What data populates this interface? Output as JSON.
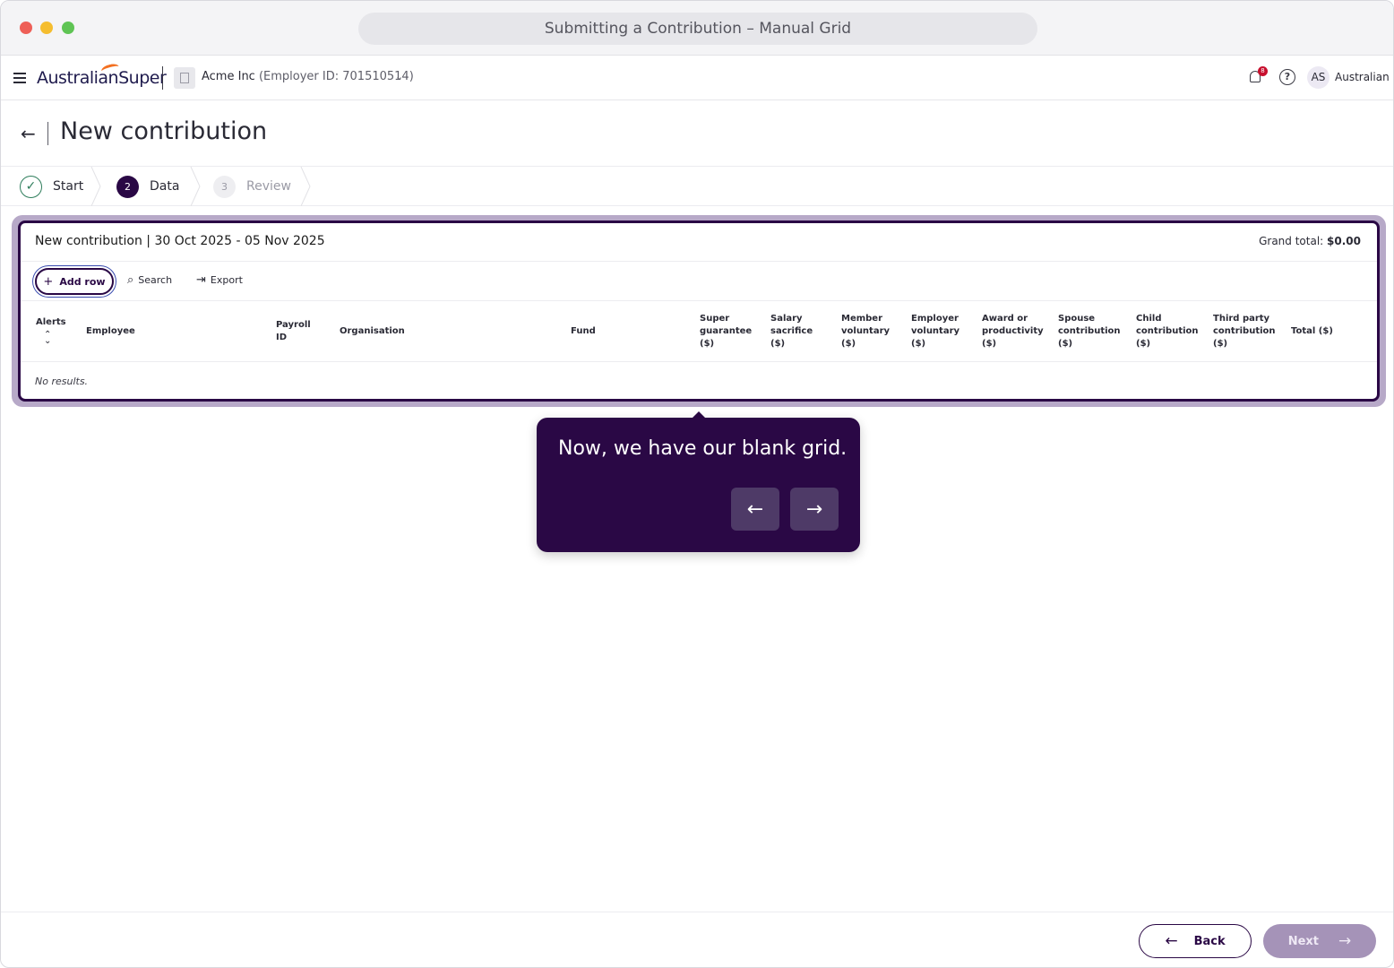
{
  "window": {
    "title": "Submitting a Contribution – Manual Grid"
  },
  "header": {
    "menu_icon": "hamburger-icon",
    "logo_text": "AustralianSuper",
    "org_name": "Acme Inc",
    "org_id": "(Employer ID: 701510514)",
    "notification_count": "8",
    "avatar_initials": "AS",
    "user_name": "Australian"
  },
  "page": {
    "title": "New contribution",
    "back_icon": "arrow-left-icon"
  },
  "stepper": {
    "steps": [
      {
        "marker": "✓",
        "label": "Start",
        "state": "complete"
      },
      {
        "marker": "2",
        "label": "Data",
        "state": "active"
      },
      {
        "marker": "3",
        "label": "Review",
        "state": "upcoming"
      }
    ]
  },
  "grid": {
    "title": "New contribution | 30 Oct 2025 - 05 Nov 2025",
    "grand_total_label": "Grand total:",
    "grand_total_value": "$0.00",
    "toolbar": {
      "add_row": "Add row",
      "search": "Search",
      "export": "Export"
    },
    "columns": [
      "Alerts",
      "Employee",
      "Payroll ID",
      "Organisation",
      "Fund",
      "Super guarantee ($)",
      "Salary sacrifice ($)",
      "Member voluntary ($)",
      "Employer voluntary ($)",
      "Award or productivity ($)",
      "Spouse contribution ($)",
      "Child contribution ($)",
      "Third party contribution ($)",
      "Total ($)"
    ],
    "empty_text": "No results."
  },
  "tooltip": {
    "text": "Now, we have our blank grid.",
    "prev_icon": "arrow-left-icon",
    "next_icon": "arrow-right-icon"
  },
  "footer": {
    "back_label": "Back",
    "next_label": "Next"
  },
  "colors": {
    "brand_primary": "#2a0845",
    "accent_orange": "#f37021",
    "success_green": "#2e7d5b",
    "next_disabled": "#a593b8"
  }
}
